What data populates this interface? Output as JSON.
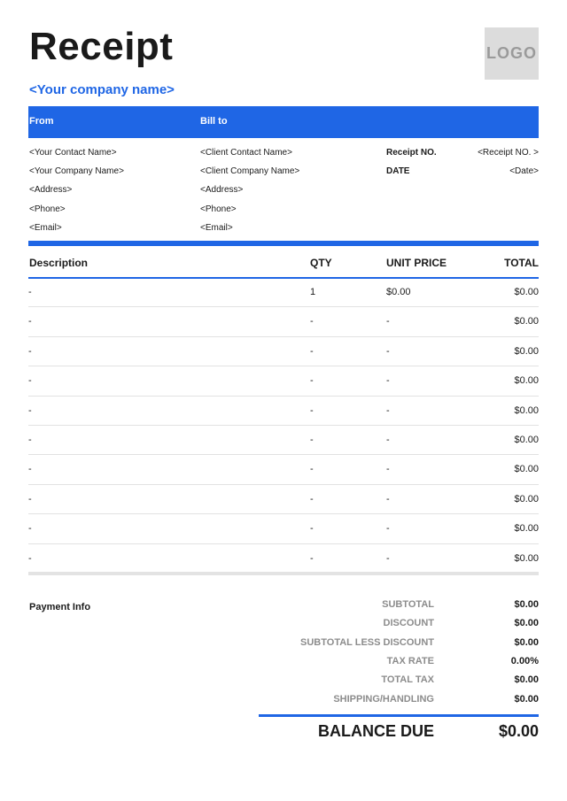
{
  "title": "Receipt",
  "logo": "LOGO",
  "company_name": "<Your company name>",
  "accent_color": "#1f66e5",
  "header_bar": {
    "from": "From",
    "bill_to": "Bill to"
  },
  "from": [
    "<Your Contact Name>",
    "<Your Company Name>",
    "<Address>",
    "<Phone>",
    "<Email>"
  ],
  "bill_to": [
    "<Client Contact Name>",
    "<Client Company Name>",
    "<Address>",
    "<Phone>",
    "<Email>"
  ],
  "meta": {
    "receipt_no_label": "Receipt NO.",
    "receipt_no_value": "<Receipt NO. >",
    "date_label": "DATE",
    "date_value": "<Date>"
  },
  "table": {
    "headers": {
      "description": "Description",
      "qty": "QTY",
      "unit_price": "UNIT PRICE",
      "total": "TOTAL"
    },
    "rows": [
      {
        "description": "-",
        "qty": "1",
        "unit_price": "$0.00",
        "total": "$0.00"
      },
      {
        "description": "-",
        "qty": "-",
        "unit_price": "-",
        "total": "$0.00"
      },
      {
        "description": "-",
        "qty": "-",
        "unit_price": "-",
        "total": "$0.00"
      },
      {
        "description": "-",
        "qty": "-",
        "unit_price": "-",
        "total": "$0.00"
      },
      {
        "description": "-",
        "qty": "-",
        "unit_price": "-",
        "total": "$0.00"
      },
      {
        "description": "-",
        "qty": "-",
        "unit_price": "-",
        "total": "$0.00"
      },
      {
        "description": "-",
        "qty": "-",
        "unit_price": "-",
        "total": "$0.00"
      },
      {
        "description": "-",
        "qty": "-",
        "unit_price": "-",
        "total": "$0.00"
      },
      {
        "description": "-",
        "qty": "-",
        "unit_price": "-",
        "total": "$0.00"
      },
      {
        "description": "-",
        "qty": "-",
        "unit_price": "-",
        "total": "$0.00"
      }
    ]
  },
  "payment_info": "Payment Info",
  "summary": [
    {
      "label": "SUBTOTAL",
      "value": "$0.00"
    },
    {
      "label": "DISCOUNT",
      "value": "$0.00"
    },
    {
      "label": "SUBTOTAL LESS DISCOUNT",
      "value": "$0.00"
    },
    {
      "label": "TAX RATE",
      "value": "0.00%"
    },
    {
      "label": "TOTAL TAX",
      "value": "$0.00"
    },
    {
      "label": "SHIPPING/HANDLING",
      "value": "$0.00"
    }
  ],
  "balance_due": {
    "label": "BALANCE DUE",
    "value": "$0.00"
  }
}
